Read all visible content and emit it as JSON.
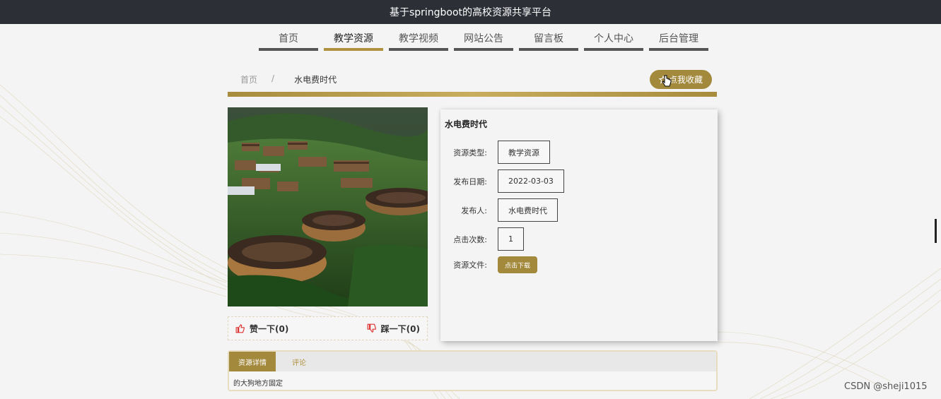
{
  "header": {
    "title": "基于springboot的高校资源共享平台"
  },
  "nav": {
    "items": [
      {
        "label": "首页",
        "active": false
      },
      {
        "label": "教学资源",
        "active": true
      },
      {
        "label": "教学视频",
        "active": false
      },
      {
        "label": "网站公告",
        "active": false
      },
      {
        "label": "留言板",
        "active": false
      },
      {
        "label": "个人中心",
        "active": false
      },
      {
        "label": "后台管理",
        "active": false
      }
    ]
  },
  "breadcrumb": {
    "home": "首页",
    "separator": "/",
    "current": "水电费时代"
  },
  "favorite": {
    "label": "点我收藏",
    "icon": "star-icon"
  },
  "votes": {
    "like_label": "赞一下(0)",
    "dislike_label": "踩一下(0)"
  },
  "resource": {
    "title": "水电费时代",
    "type_label": "资源类型:",
    "type_value": "教学资源",
    "date_label": "发布日期:",
    "date_value": "2022-03-03",
    "publisher_label": "发布人:",
    "publisher_value": "水电费时代",
    "clicks_label": "点击次数:",
    "clicks_value": "1",
    "file_label": "资源文件:",
    "download_label": "点击下载"
  },
  "tabs": {
    "items": [
      {
        "label": "资源详情",
        "active": true
      },
      {
        "label": "评论",
        "active": false
      }
    ],
    "content": "的大狗地方固定"
  },
  "watermark": "CSDN @sheji1015",
  "colors": {
    "accent": "#a3893c",
    "topbar": "#2c2f36",
    "background": "#f4f4f4"
  }
}
